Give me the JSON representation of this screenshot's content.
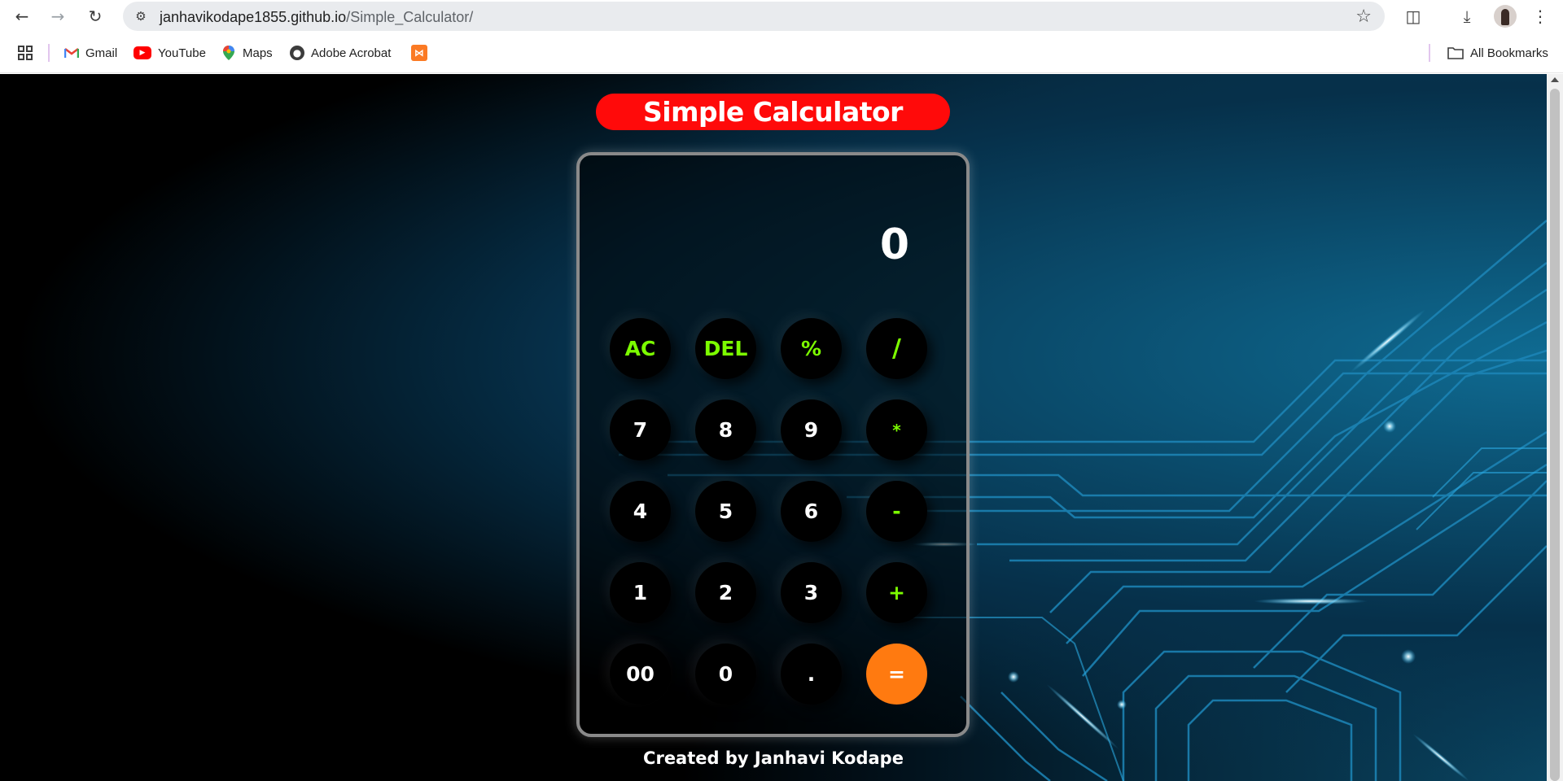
{
  "browser": {
    "url_host": "janhavikodape1855.github.io",
    "url_path": "/Simple_Calculator/",
    "bookmarks": [
      {
        "label": "Gmail",
        "icon": "gmail-icon"
      },
      {
        "label": "YouTube",
        "icon": "youtube-icon"
      },
      {
        "label": "Maps",
        "icon": "maps-icon"
      },
      {
        "label": "Adobe Acrobat",
        "icon": "globe-icon"
      },
      {
        "label": "",
        "icon": "xampp-icon"
      }
    ],
    "all_bookmarks": "All Bookmarks"
  },
  "app": {
    "title": "Simple Calculator",
    "display": "0",
    "credit": "Created by Janhavi Kodape"
  },
  "keys": {
    "ac": "AC",
    "del": "DEL",
    "percent": "%",
    "divide": "/",
    "k7": "7",
    "k8": "8",
    "k9": "9",
    "multiply": "*",
    "k4": "4",
    "k5": "5",
    "k6": "6",
    "minus": "-",
    "k1": "1",
    "k2": "2",
    "k3": "3",
    "plus": "+",
    "k00": "00",
    "k0": "0",
    "dot": ".",
    "equals": "="
  },
  "colors": {
    "title_bg": "#ff0a0a",
    "operator_text": "#7cfc00",
    "equals_bg": "#ff7a10"
  }
}
